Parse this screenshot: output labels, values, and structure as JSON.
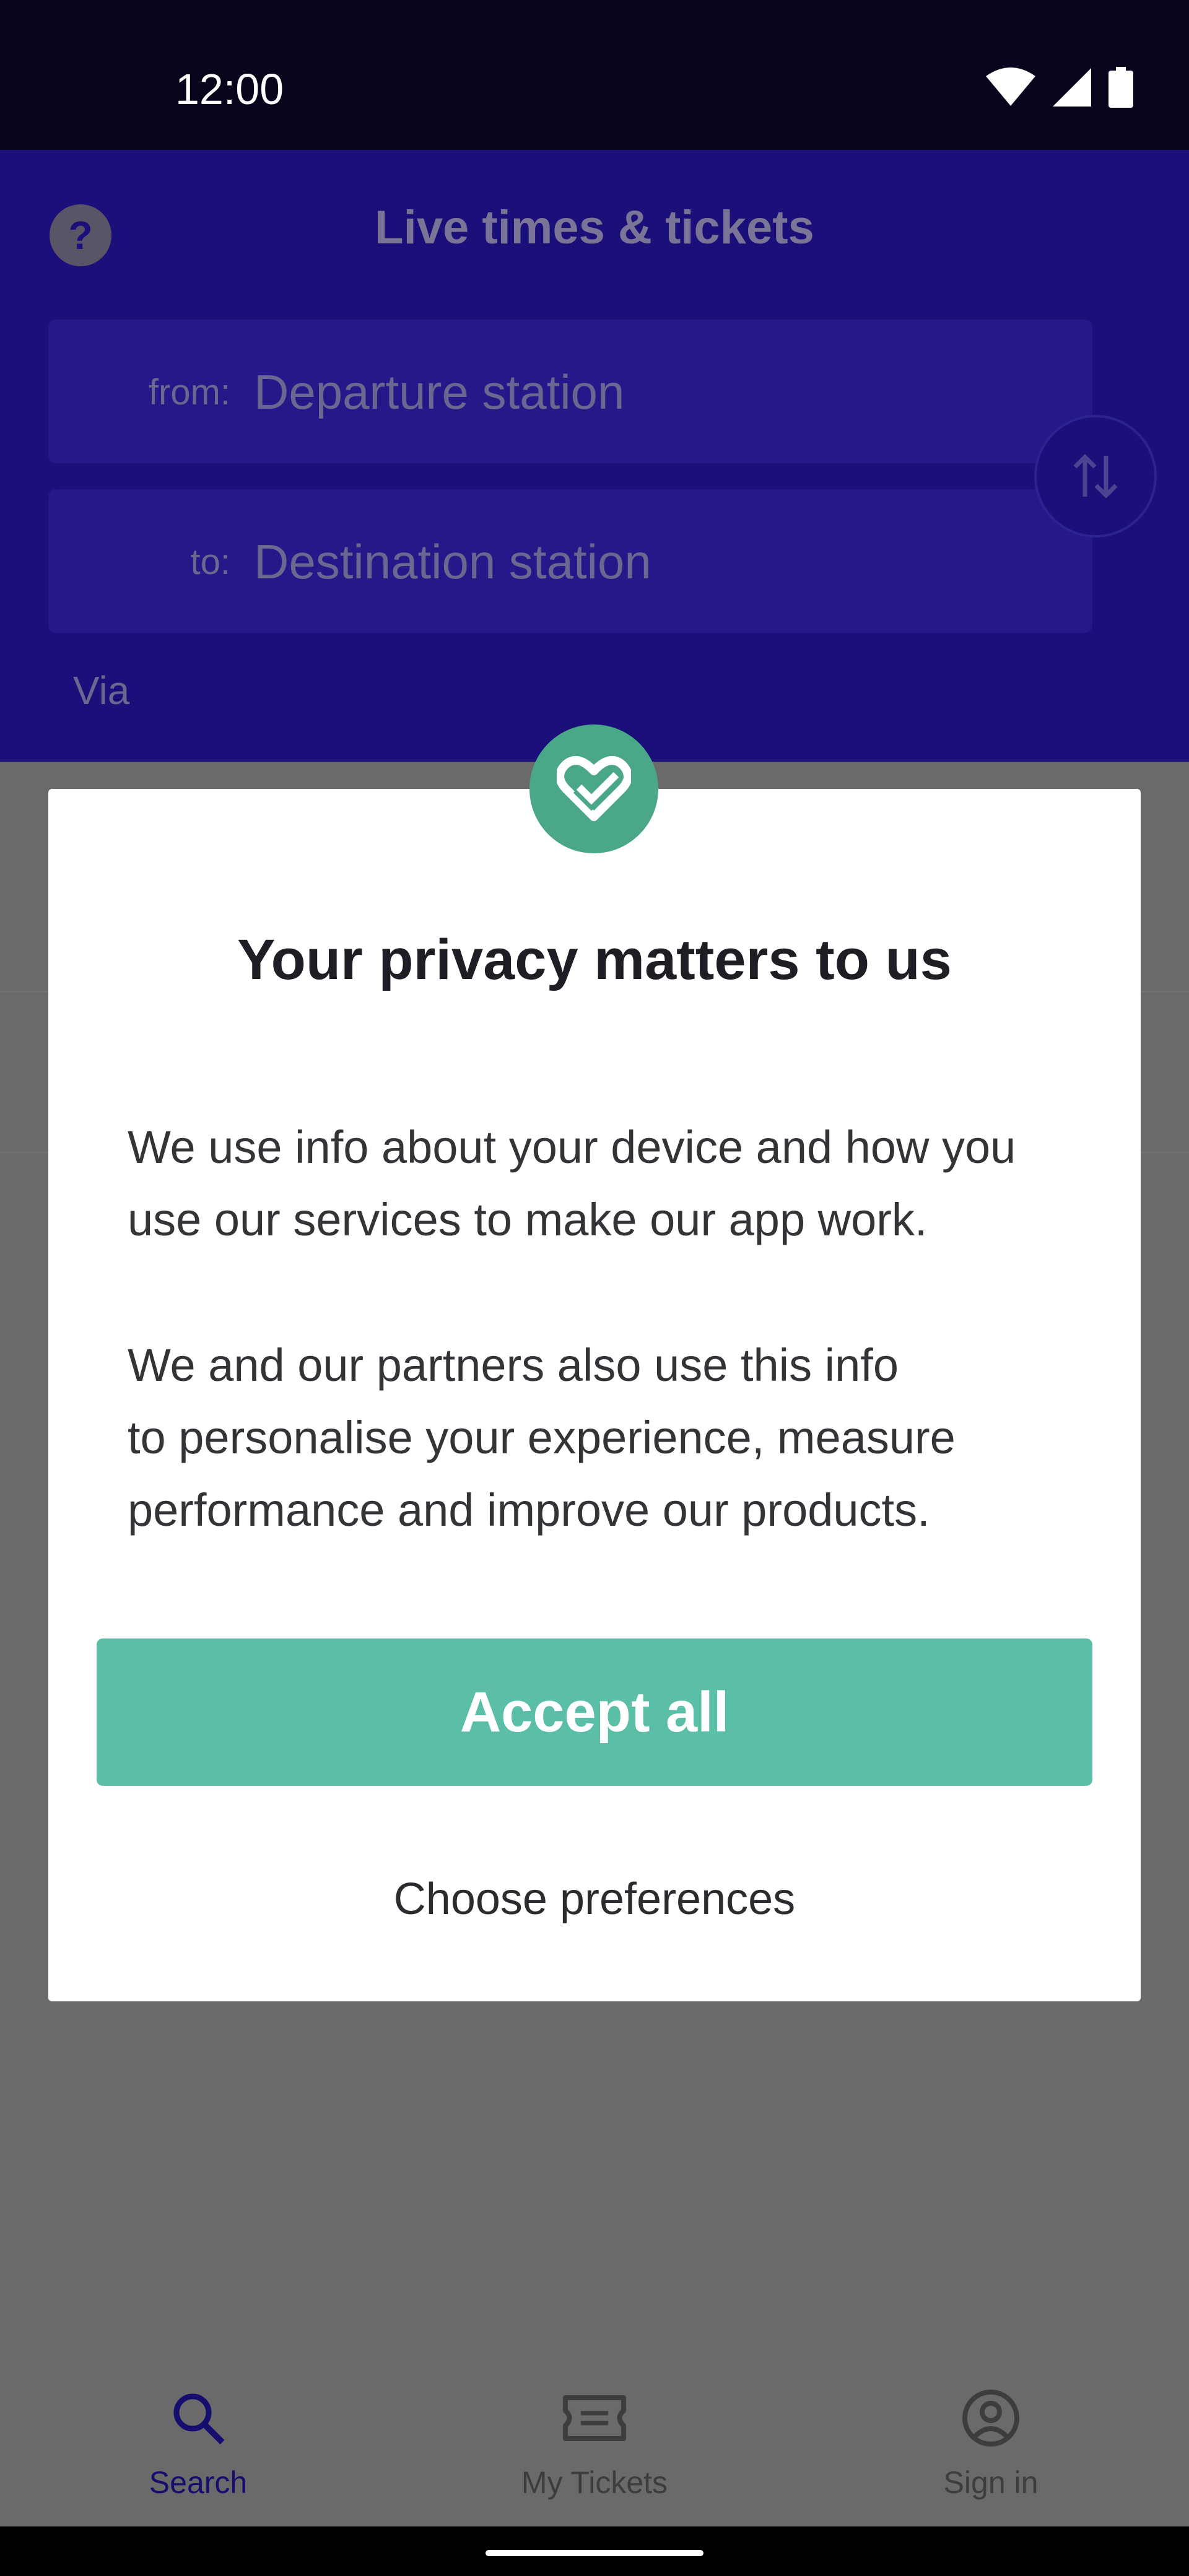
{
  "status_bar": {
    "time": "12:00",
    "icons": [
      "wifi-icon",
      "signal-icon",
      "battery-icon"
    ]
  },
  "header": {
    "title": "Live times & tickets",
    "help_icon": "?",
    "from_label": "from:",
    "from_placeholder": "Departure station",
    "to_label": "to:",
    "to_placeholder": "Destination station",
    "via_label": "Via"
  },
  "dialog": {
    "title": "Your privacy matters to us",
    "paragraph1_line1": "We use info about your device and how you",
    "paragraph1_line2": "use our services to make our app work.",
    "paragraph2_line1": "We and our partners also use this info",
    "paragraph2_line2": "to personalise your experience, measure",
    "paragraph2_line3": "performance and improve our products.",
    "accept_label": "Accept all",
    "preferences_label": "Choose preferences"
  },
  "bottom_nav": {
    "items": [
      {
        "label": "Search",
        "icon": "search-icon",
        "active": true
      },
      {
        "label": "My Tickets",
        "icon": "ticket-icon",
        "active": false
      },
      {
        "label": "Sign in",
        "icon": "account-icon",
        "active": false
      }
    ]
  },
  "colors": {
    "header_bg": "#1b0f7a",
    "accent_green": "#5bbfa7",
    "badge_green": "#4aa889",
    "overlay_gray": "#6a6a6a",
    "active_nav": "#160e6e"
  }
}
